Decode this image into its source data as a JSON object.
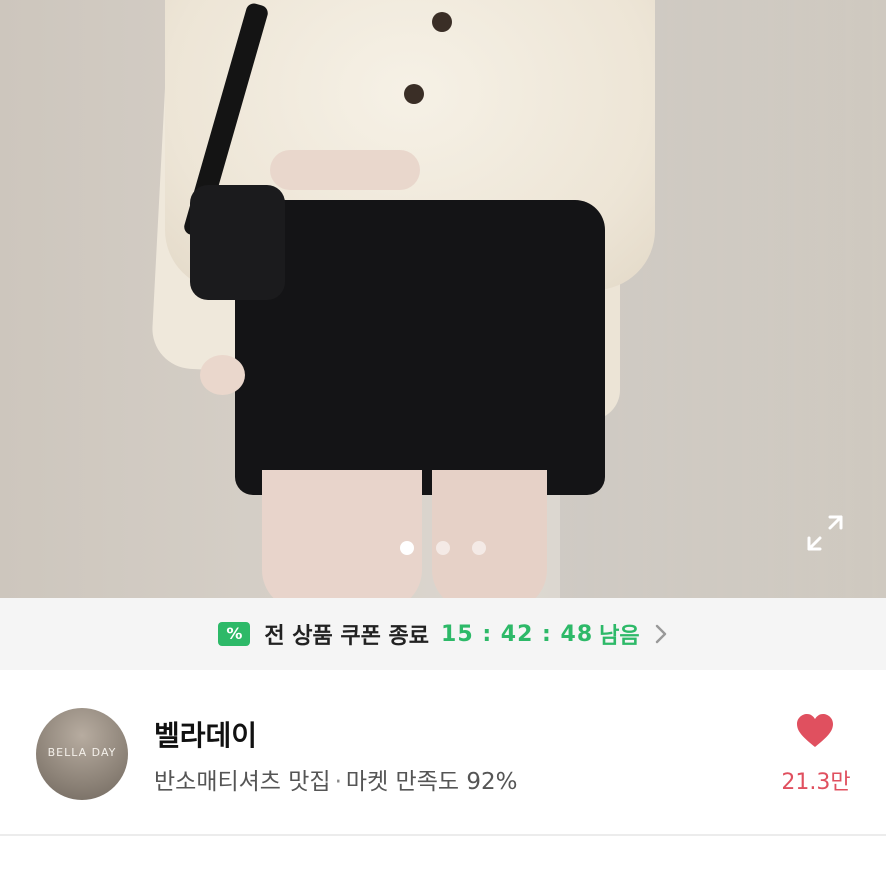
{
  "product_image": {
    "alt": "cream cable-knit cardigan and black shorts",
    "pager": {
      "total": 3,
      "active": 1
    },
    "expand_icon": "expand-icon"
  },
  "coupon_bar": {
    "icon": "coupon-ticket-icon",
    "icon_glyph": "%",
    "text": "전 상품 쿠폰 종료",
    "timer": "15 : 42 : 48",
    "remain_label": "남음",
    "chevron": "chevron-right-icon",
    "accent_color": "#2db968"
  },
  "shop": {
    "avatar_text": "BELLA DAY",
    "name": "벨라데이",
    "tagline": "반소매티셔츠 맛집",
    "separator": "·",
    "satisfaction": "마켓 만족도 92%",
    "likes": "21.3만",
    "like_color": "#e0505f",
    "like_icon": "heart-icon"
  }
}
